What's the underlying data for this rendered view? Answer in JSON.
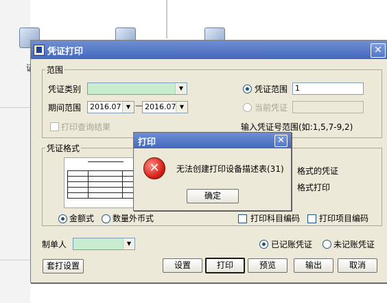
{
  "background": {
    "label": "证"
  },
  "dialog": {
    "title": "凭证打印",
    "range": {
      "legend": "范围",
      "voucher_type_label": "凭证类别",
      "voucher_type_value": "",
      "period_label": "期间范围",
      "period_from": "2016.07",
      "period_dash": "—",
      "period_to": "2016.07",
      "print_query_results": "打印查询结果",
      "voucher_range_label": "凭证范围",
      "voucher_range_value": "1",
      "current_voucher_label": "当前凭证",
      "current_voucher_value": "",
      "hint": "输入凭证号范围(如:1,5,7-9,2)"
    },
    "format": {
      "legend": "凭证格式",
      "right_text_1": "格式的凭证",
      "right_text_2": "格式打印",
      "amount_style": "金额式",
      "quantity_foreign_style": "数量外币式",
      "print_subject_code": "打印科目编码",
      "print_item_code": "打印项目编码"
    },
    "maker_label": "制单人",
    "maker_value": "",
    "posted_label": "已记账凭证",
    "unposted_label": "未记账凭证",
    "buttons": {
      "overprint_settings": "套打设置",
      "settings": "设置",
      "print": "打印",
      "preview": "预览",
      "export": "输出",
      "cancel": "取消"
    }
  },
  "error_dialog": {
    "title": "打印",
    "message": "无法创建打印设备描述表(31)",
    "ok": "确定"
  }
}
